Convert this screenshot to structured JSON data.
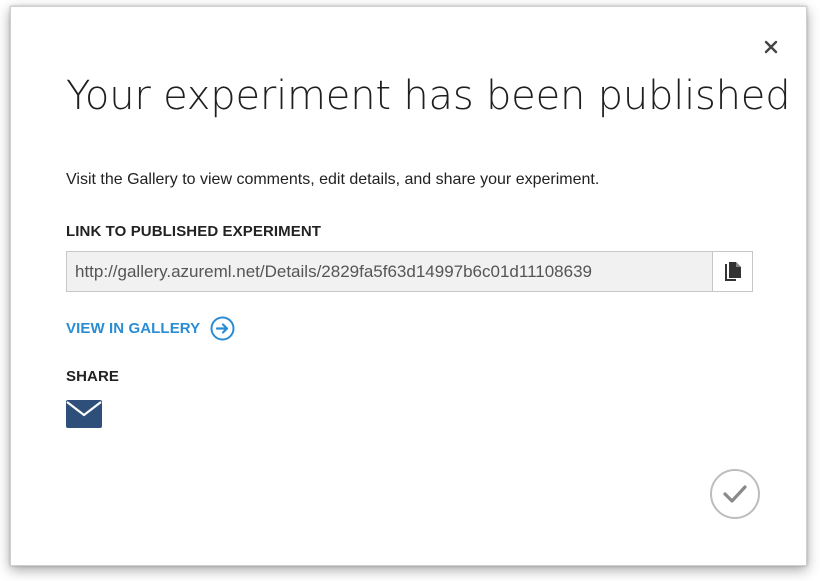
{
  "dialog": {
    "title": "Your experiment has been published",
    "description": "Visit the Gallery to view comments, edit details, and share your experiment.",
    "link_label": "LINK TO PUBLISHED EXPERIMENT",
    "link_value": "http://gallery.azureml.net/Details/2829fa5f63d14997b6c01d11108639",
    "view_gallery_label": "VIEW IN GALLERY",
    "share_label": "SHARE"
  },
  "icons": {
    "close": "close-icon",
    "copy": "copy-icon",
    "view_gallery": "arrow-circle-right-icon",
    "share_email": "email-icon",
    "ok": "checkmark-circle-icon"
  },
  "colors": {
    "accent_blue": "#2a8dd4",
    "email_icon": "#2d4f7a",
    "ok_circle": "#bdbdbd"
  }
}
